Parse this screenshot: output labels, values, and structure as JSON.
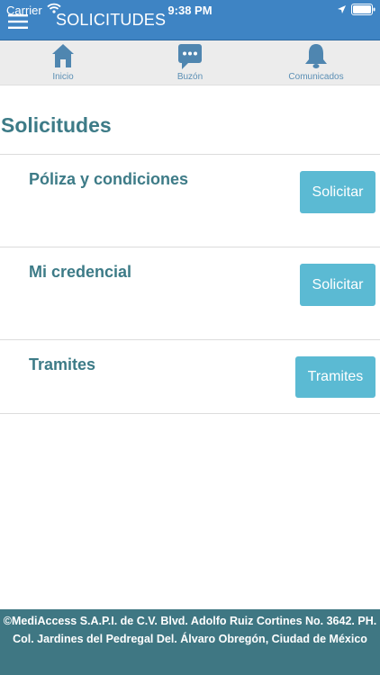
{
  "status_bar": {
    "carrier": "Carrier",
    "time": "9:38 PM"
  },
  "header": {
    "title": "SOLICITUDES",
    "color": "#3e84c4"
  },
  "tabs": [
    {
      "label": "Inicio",
      "icon": "home-icon"
    },
    {
      "label": "Buzón",
      "icon": "chat-bubble-icon"
    },
    {
      "label": "Comunicados",
      "icon": "bell-icon"
    }
  ],
  "page": {
    "title": "Solicitudes"
  },
  "requests": [
    {
      "label": "Póliza y condiciones",
      "button": "Solicitar"
    },
    {
      "label": "Mi credencial",
      "button": "Solicitar"
    },
    {
      "label": "Tramites",
      "button": "Tramites"
    }
  ],
  "colors": {
    "accent_text": "#3d7b87",
    "button": "#5bbad3",
    "footer": "#3f7783",
    "tab_icon": "#4f86b0"
  },
  "footer": {
    "text": "©MediAccess S.A.P.I. de C.V. Blvd. Adolfo Ruiz Cortines No. 3642. PH. Col. Jardines del Pedregal Del. Álvaro Obregón, Ciudad de México"
  }
}
